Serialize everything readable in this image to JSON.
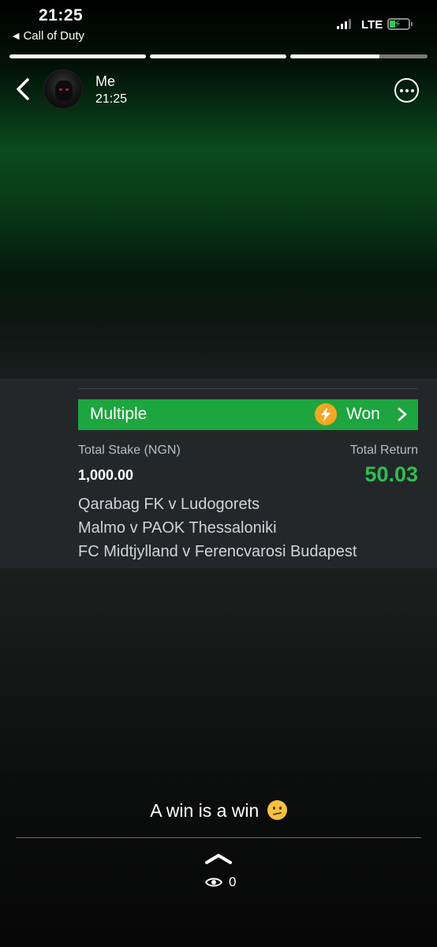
{
  "status_bar": {
    "time": "21:25",
    "back_app": "Call of Duty",
    "network": "LTE",
    "signal_bars": 3,
    "signal_bars_max": 4,
    "battery_level": 0.3,
    "charging": true
  },
  "story": {
    "progress": [
      1.0,
      1.0,
      0.65
    ],
    "user_name": "Me",
    "post_time": "21:25"
  },
  "bet": {
    "type": "Multiple",
    "status": "Won",
    "stake_label": "Total Stake (NGN)",
    "stake": "1,000.00",
    "return_label": "Total Return",
    "return": "50.03",
    "matches": [
      "Qarabag FK v Ludogorets",
      "Malmo v PAOK Thessaloniki",
      "FC Midtjylland v Ferencvarosi Budapest"
    ],
    "colors": {
      "bar": "#1da53f",
      "return": "#2fbf4f",
      "bolt": "#f7a623"
    }
  },
  "caption": {
    "text": "A win is a win",
    "emoji": "confused-face"
  },
  "footer": {
    "views": "0"
  }
}
